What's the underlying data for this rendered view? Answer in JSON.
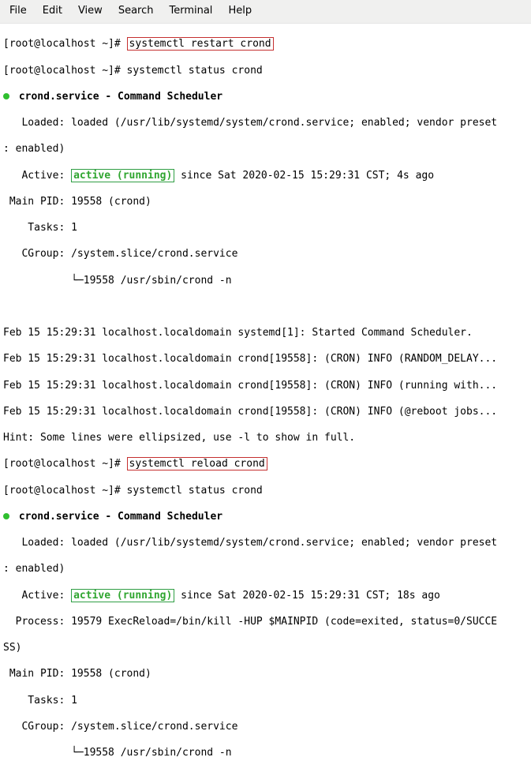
{
  "menu": {
    "file": "File",
    "edit": "Edit",
    "view": "View",
    "search": "Search",
    "terminal": "Terminal",
    "help": "Help"
  },
  "t": {
    "p1": "[root@localhost ~]# ",
    "c1": "systemctl restart crond",
    "p2": "[root@localhost ~]# systemctl status crond",
    "svc_hdr": " crond.service - Command Scheduler",
    "loaded_l1": "   Loaded: loaded (/usr/lib/systemd/system/crond.service; enabled; vendor preset",
    "loaded_l2": ": enabled)",
    "active_lbl": "   Active: ",
    "active_val": "active (running)",
    "active_since1": " since Sat 2020-02-15 15:29:31 CST; 4s ago",
    "mainpid1": " Main PID: 19558 (crond)",
    "tasks1": "    Tasks: 1",
    "cgroup1": "   CGroup: /system.slice/crond.service",
    "cgroup1b": "           └─19558 /usr/sbin/crond -n",
    "log1": "Feb 15 15:29:31 localhost.localdomain systemd[1]: Started Command Scheduler.",
    "log2": "Feb 15 15:29:31 localhost.localdomain crond[19558]: (CRON) INFO (RANDOM_DELAY...",
    "log3": "Feb 15 15:29:31 localhost.localdomain crond[19558]: (CRON) INFO (running with...",
    "log4": "Feb 15 15:29:31 localhost.localdomain crond[19558]: (CRON) INFO (@reboot jobs...",
    "hint": "Hint: Some lines were ellipsized, use -l to show in full.",
    "p3": "[root@localhost ~]# ",
    "c3": "systemctl reload crond",
    "p4": "[root@localhost ~]# systemctl status crond",
    "active_since2": " since Sat 2020-02-15 15:29:31 CST; 18s ago",
    "process2a": "  Process: 19579 ExecReload=/bin/kill -HUP $MAINPID (code=exited, status=0/SUCCE",
    "process2b": "SS)",
    "mainpid2": " Main PID: 19558 (crond)",
    "tasks2": "    Tasks: 1",
    "cgroup2": "   CGroup: /system.slice/crond.service",
    "cgroup2b": "           └─19558 /usr/sbin/crond -n"
  }
}
